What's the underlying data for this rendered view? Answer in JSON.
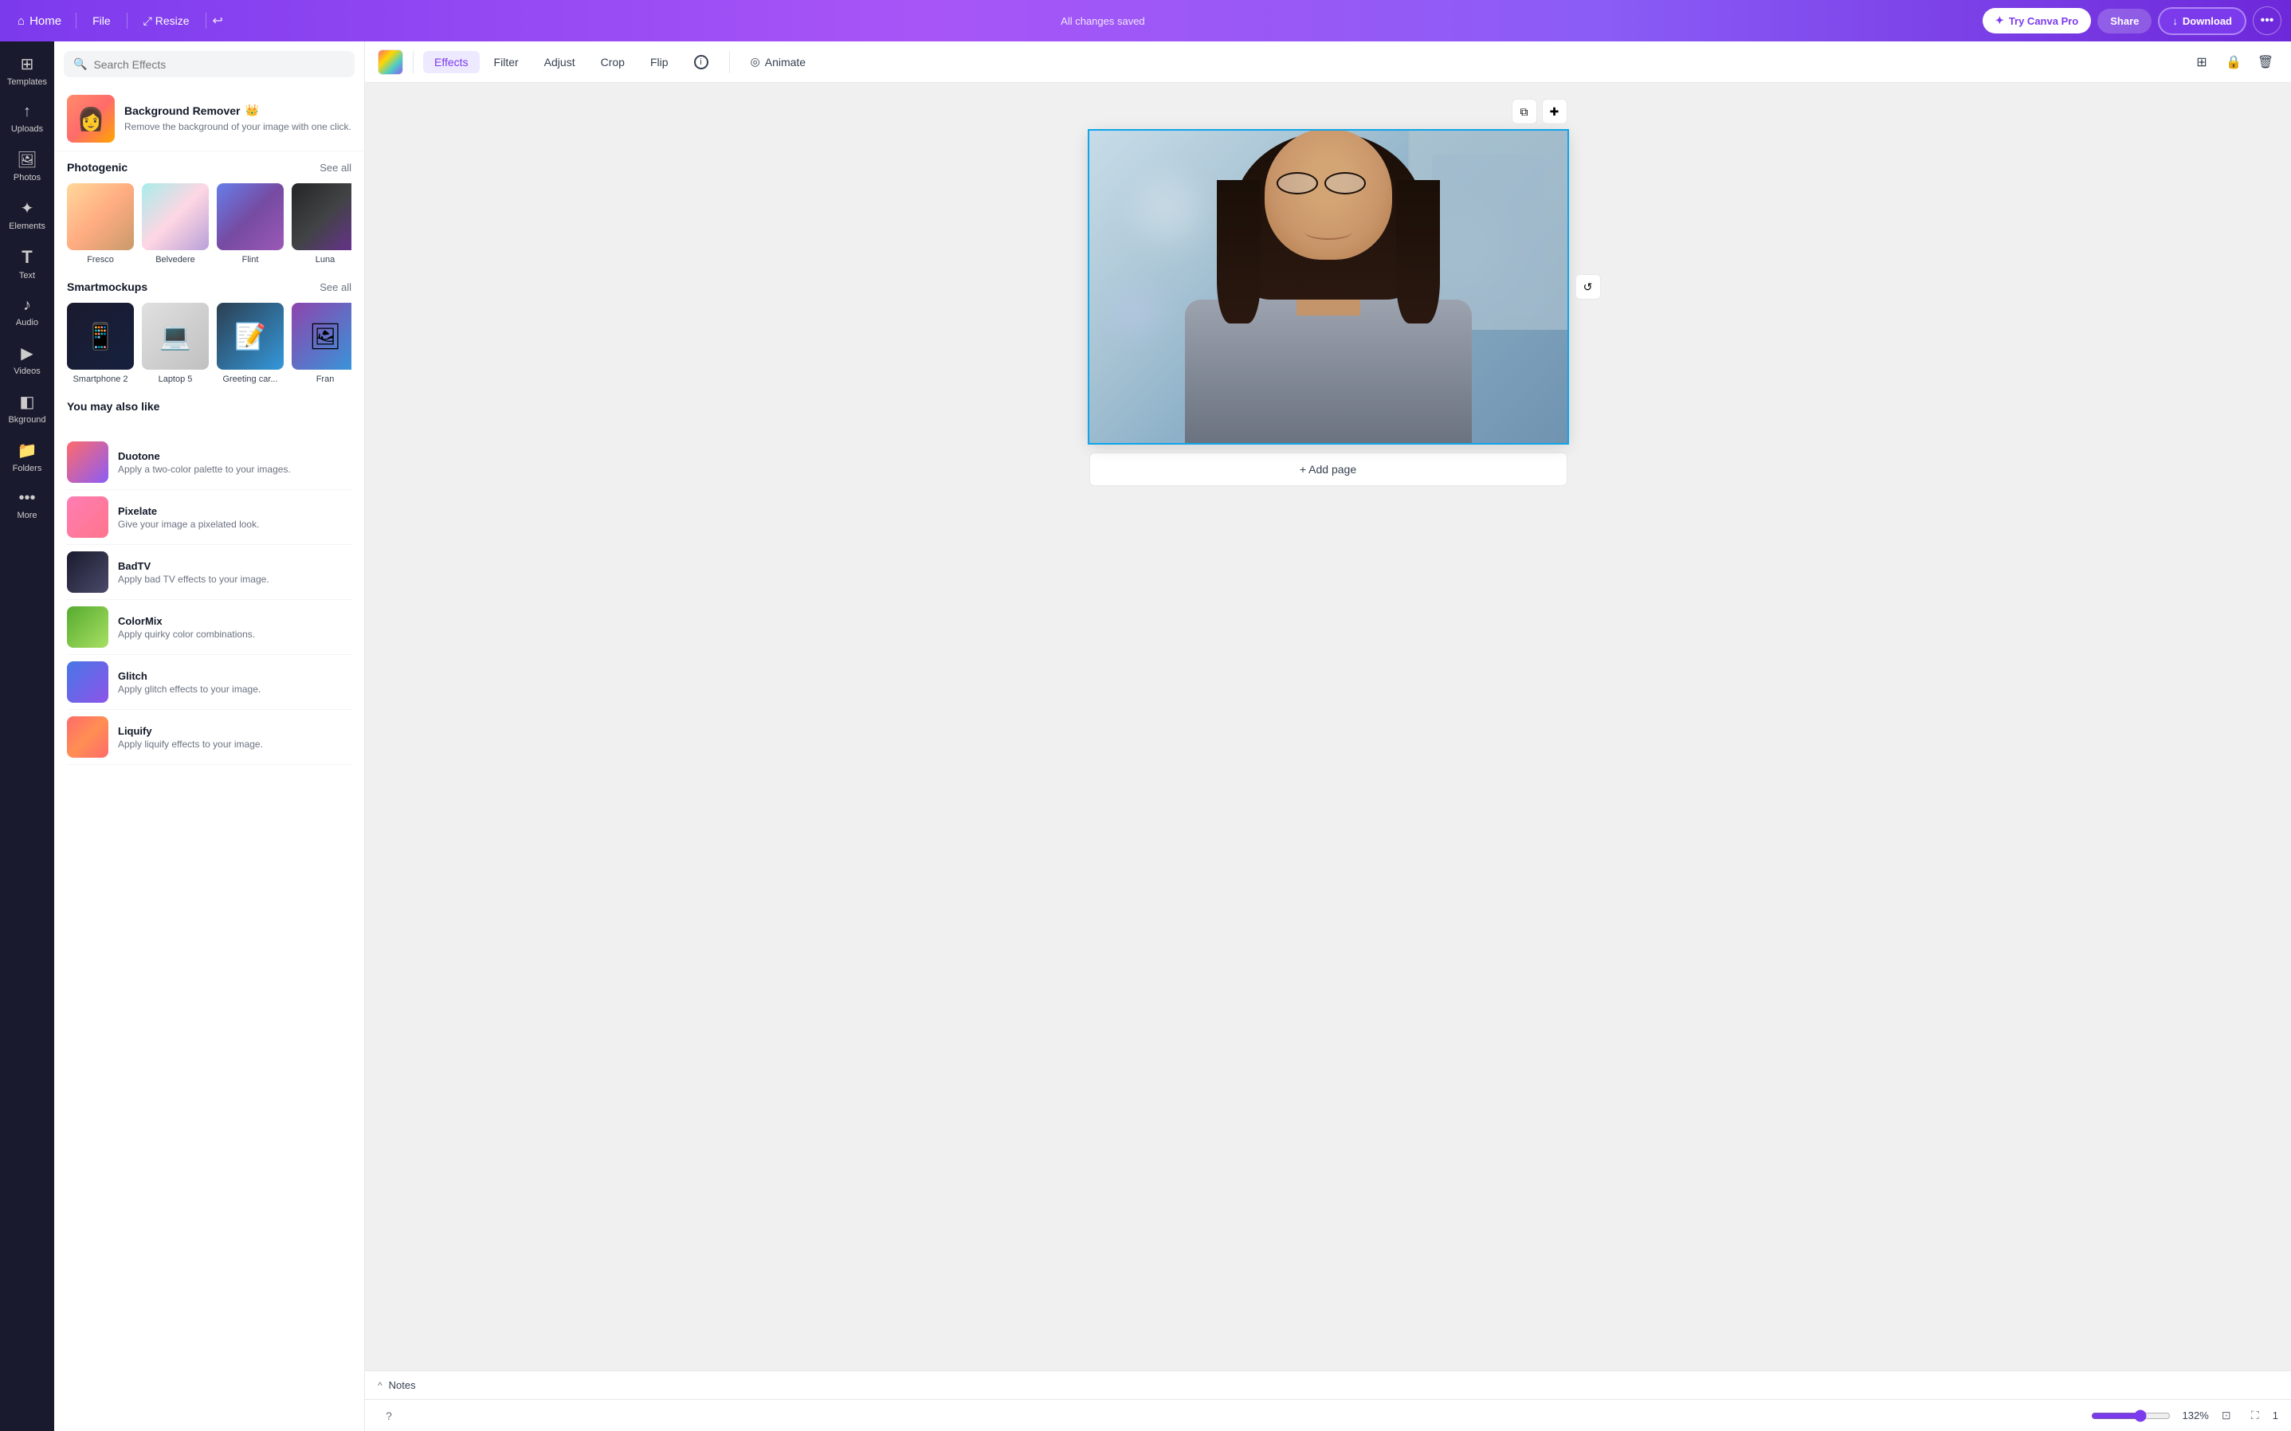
{
  "topbar": {
    "home_label": "Home",
    "file_label": "File",
    "resize_label": "Resize",
    "saved_status": "All changes saved",
    "try_canva_pro_label": "Try Canva Pro",
    "share_label": "Share",
    "download_label": "Download"
  },
  "sidebar": {
    "items": [
      {
        "id": "templates",
        "icon": "⊞",
        "label": "Templates"
      },
      {
        "id": "uploads",
        "icon": "↑",
        "label": "Uploads"
      },
      {
        "id": "photos",
        "icon": "🖼",
        "label": "Photos"
      },
      {
        "id": "elements",
        "icon": "✦",
        "label": "Elements"
      },
      {
        "id": "text",
        "icon": "T",
        "label": "Text"
      },
      {
        "id": "audio",
        "icon": "♪",
        "label": "Audio"
      },
      {
        "id": "videos",
        "icon": "▶",
        "label": "Videos"
      },
      {
        "id": "bkground",
        "icon": "◧",
        "label": "Bkground"
      },
      {
        "id": "folders",
        "icon": "📁",
        "label": "Folders"
      },
      {
        "id": "more",
        "icon": "•••",
        "label": "More"
      }
    ]
  },
  "effects_panel": {
    "search_placeholder": "Search Effects",
    "bg_remover": {
      "title": "Background Remover",
      "description": "Remove the background of your image with one click."
    },
    "photogenic": {
      "title": "Photogenic",
      "see_all": "See all",
      "items": [
        {
          "name": "Fresco",
          "class": "thumb-fresco"
        },
        {
          "name": "Belvedere",
          "class": "thumb-belvedere"
        },
        {
          "name": "Flint",
          "class": "thumb-flint"
        },
        {
          "name": "Luna",
          "class": "thumb-luna"
        }
      ]
    },
    "smartmockups": {
      "title": "Smartmockups",
      "see_all": "See all",
      "items": [
        {
          "name": "Smartphone 2",
          "class": "mock-thumb-sm2",
          "icon": "📱"
        },
        {
          "name": "Laptop 5",
          "class": "mock-thumb-laptop",
          "icon": "💻"
        },
        {
          "name": "Greeting car...",
          "class": "mock-thumb-greeting",
          "icon": "📝"
        },
        {
          "name": "Fran",
          "class": "mock-thumb-fran",
          "icon": "🖼"
        }
      ]
    },
    "you_may_also_like": {
      "title": "You may also like",
      "items": [
        {
          "name": "Duotone",
          "description": "Apply a two-color palette to your images.",
          "class": "thumb-duotone"
        },
        {
          "name": "Pixelate",
          "description": "Give your image a pixelated look.",
          "class": "thumb-pixelate"
        },
        {
          "name": "BadTV",
          "description": "Apply bad TV effects to your image.",
          "class": "thumb-badtv"
        },
        {
          "name": "ColorMix",
          "description": "Apply quirky color combinations.",
          "class": "thumb-colormix"
        },
        {
          "name": "Glitch",
          "description": "Apply glitch effects to your image.",
          "class": "thumb-glitch"
        },
        {
          "name": "Liquify",
          "description": "Apply liquify effects to your image.",
          "class": "thumb-liquify"
        }
      ]
    }
  },
  "toolbar": {
    "effects_label": "Effects",
    "filter_label": "Filter",
    "adjust_label": "Adjust",
    "crop_label": "Crop",
    "flip_label": "Flip",
    "animate_label": "Animate"
  },
  "canvas": {
    "add_page_label": "+ Add page"
  },
  "notes": {
    "label": "Notes"
  },
  "bottom_bar": {
    "zoom_level": "132%",
    "page_number": "1"
  }
}
